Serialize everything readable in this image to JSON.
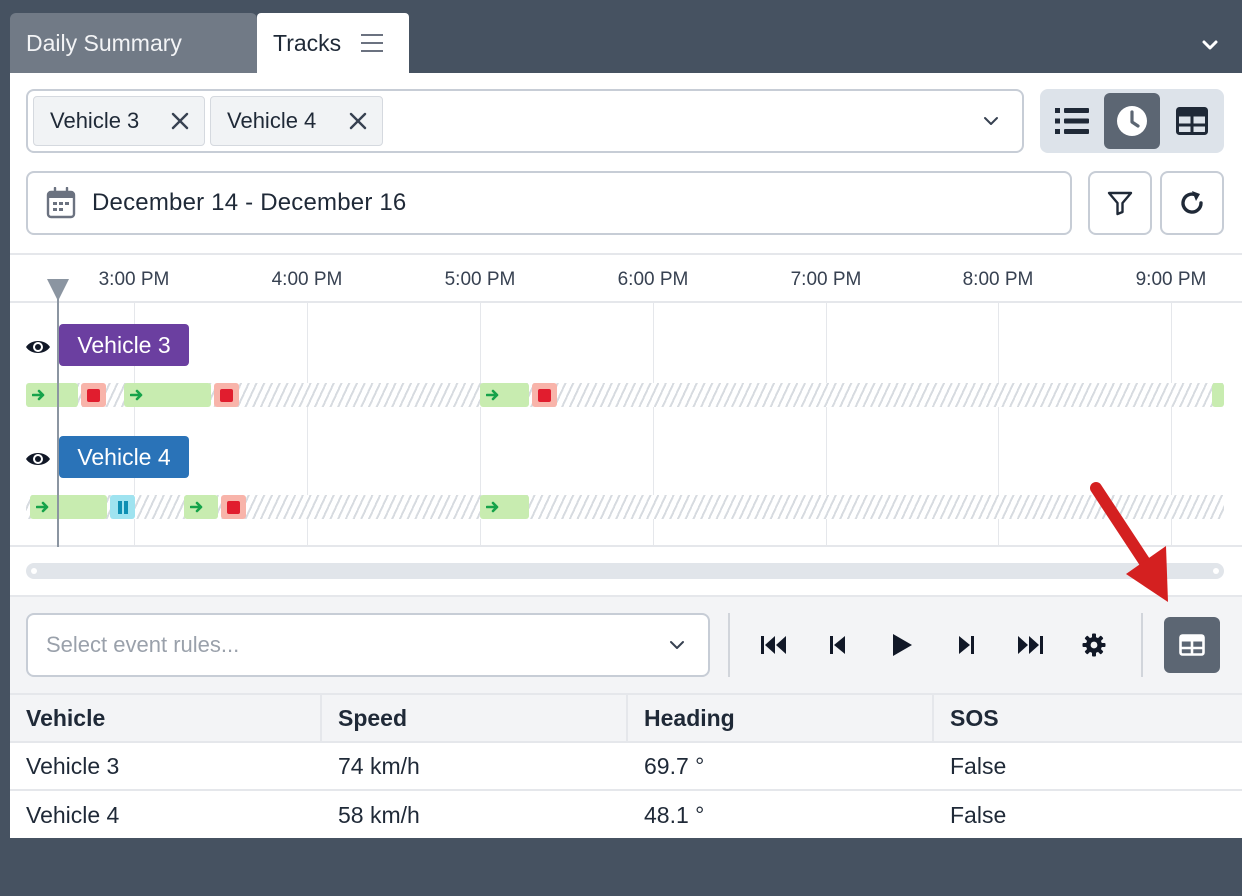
{
  "tabs": [
    {
      "label": "Daily Summary",
      "active": false
    },
    {
      "label": "Tracks",
      "active": true
    }
  ],
  "icons": {
    "tab_menu": "hamburger-icon",
    "collapse": "chevron-down-icon",
    "view_list": "list-icon",
    "view_timeline": "clock-icon",
    "view_table": "table-icon",
    "calendar": "calendar-icon",
    "filter": "filter-icon",
    "refresh": "refresh-icon",
    "visibility": "eye-icon",
    "move": "arrow-right-icon",
    "stop": "stop-icon",
    "pause": "pause-icon",
    "settings": "gear-icon"
  },
  "vehicle_select": {
    "chips": [
      {
        "label": "Vehicle 3"
      },
      {
        "label": "Vehicle 4"
      }
    ]
  },
  "view_toggle": {
    "active": "timeline"
  },
  "date_range": {
    "text": "December 14 - December 16"
  },
  "timeline": {
    "ticks": [
      "3:00 PM",
      "4:00 PM",
      "5:00 PM",
      "6:00 PM",
      "7:00 PM",
      "8:00 PM",
      "9:00 PM"
    ],
    "vehicles": [
      {
        "label": "Vehicle 3",
        "color": "#6b3fa0"
      },
      {
        "label": "Vehicle 4",
        "color": "#2a73b8"
      }
    ]
  },
  "event_rules": {
    "placeholder": "Select event rules..."
  },
  "colors": {
    "move_segment": "#c8ecb0",
    "stop_segment": "#f8b4aa",
    "pause_segment": "#9fe3f0",
    "annotation_arrow": "#d42020"
  },
  "table": {
    "headers": [
      "Vehicle",
      "Speed",
      "Heading",
      "SOS"
    ],
    "rows": [
      [
        "Vehicle 3",
        "74 km/h",
        "69.7 °",
        "False"
      ],
      [
        "Vehicle 4",
        "58 km/h",
        "48.1 °",
        "False"
      ]
    ]
  }
}
